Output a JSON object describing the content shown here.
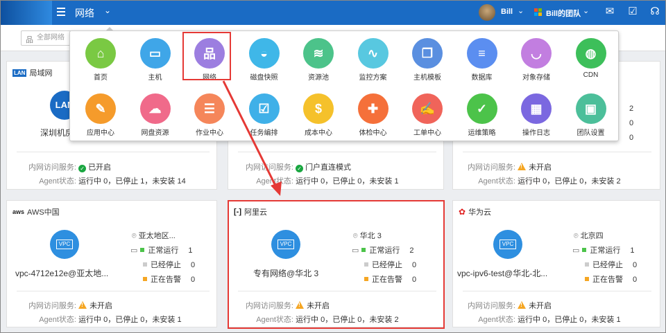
{
  "topbar": {
    "title": "网络",
    "user": "Bill",
    "team": "Bill的团队"
  },
  "search": {
    "placeholder": "全部网络"
  },
  "menu": [
    {
      "label": "首页",
      "color": "#7ac943",
      "icon": "home-icon",
      "glyph": "⌂"
    },
    {
      "label": "主机",
      "color": "#3fa6e8",
      "icon": "monitor-icon",
      "glyph": "▭"
    },
    {
      "label": "网络",
      "color": "#9c7ee0",
      "icon": "network-icon",
      "glyph": "品"
    },
    {
      "label": "磁盘快照",
      "color": "#3fb7e8",
      "icon": "disk-icon",
      "glyph": "◒"
    },
    {
      "label": "资源池",
      "color": "#4cc38a",
      "icon": "layers-icon",
      "glyph": "≋"
    },
    {
      "label": "监控方案",
      "color": "#58c8e0",
      "icon": "monitor-chart-icon",
      "glyph": "∿"
    },
    {
      "label": "主机模板",
      "color": "#5a8fe0",
      "icon": "template-icon",
      "glyph": "❐"
    },
    {
      "label": "数据库",
      "color": "#5b8ef0",
      "icon": "database-icon",
      "glyph": "≡"
    },
    {
      "label": "对象存储",
      "color": "#c27ee0",
      "icon": "bucket-icon",
      "glyph": "◡"
    },
    {
      "label": "CDN",
      "color": "#3dbf5a",
      "icon": "globe-icon",
      "glyph": "◍"
    },
    {
      "label": "应用中心",
      "color": "#f59b2b",
      "icon": "wrench-icon",
      "glyph": "✎"
    },
    {
      "label": "网盘资源",
      "color": "#f06a8a",
      "icon": "cloud-icon",
      "glyph": "☁"
    },
    {
      "label": "作业中心",
      "color": "#f5865a",
      "icon": "clipboard-icon",
      "glyph": "☰"
    },
    {
      "label": "任务编排",
      "color": "#3fb0e8",
      "icon": "task-icon",
      "glyph": "☑"
    },
    {
      "label": "成本中心",
      "color": "#f5c12b",
      "icon": "dollar-icon",
      "glyph": "$"
    },
    {
      "label": "体检中心",
      "color": "#f5703a",
      "icon": "medkit-icon",
      "glyph": "✚"
    },
    {
      "label": "工单中心",
      "color": "#f0645a",
      "icon": "ticket-icon",
      "glyph": "✍"
    },
    {
      "label": "运维策略",
      "color": "#4cc34a",
      "icon": "shield-icon",
      "glyph": "✓"
    },
    {
      "label": "操作日志",
      "color": "#7b68e0",
      "icon": "calendar-icon",
      "glyph": "▦"
    },
    {
      "label": "团队设置",
      "color": "#4cbf9a",
      "icon": "grid-icon",
      "glyph": "▣"
    }
  ],
  "cards": [
    {
      "provider": "局域网",
      "badge": "LAN",
      "vpc_name": "深圳机房",
      "vpc_glyph": "LAN",
      "loc": "",
      "running": "",
      "stopped": "",
      "alert": "",
      "service_label": "内网访问服务:",
      "service": "已开启",
      "service_ok": true,
      "agent_label": "Agent状态:",
      "agent": "运行中 0，已停止 1，未安装 14"
    },
    {
      "provider": "",
      "badge": "",
      "vpc_name": "",
      "vpc_glyph": "",
      "loc": "",
      "running": "",
      "stopped": "",
      "alert": "",
      "service_label": "内网访问服务:",
      "service": "门户直连模式",
      "service_ok": true,
      "agent_label": "Agent状态:",
      "agent": "运行中 0，已停止 0，未安装 1"
    },
    {
      "provider": "",
      "badge": "",
      "vpc_name": "",
      "vpc_glyph": "",
      "loc": "",
      "running": "2",
      "stopped": "0",
      "alert": "0",
      "service_label": "内网访问服务:",
      "service": "未开启",
      "service_ok": false,
      "agent_label": "Agent状态:",
      "agent": "运行中 0，已停止 0，未安装 2"
    },
    {
      "provider": "AWS中国",
      "badge": "aws",
      "vpc_name": "vpc-4712e12e@亚太地...",
      "vpc_glyph": "VPC",
      "loc": "亚太地区...",
      "running": "1",
      "stopped": "0",
      "alert": "0",
      "service_label": "内网访问服务:",
      "service": "未开启",
      "service_ok": false,
      "agent_label": "Agent状态:",
      "agent": "运行中 0，已停止 0，未安装 1"
    },
    {
      "provider": "阿里云",
      "badge": "ali",
      "vpc_name": "专有网络@华北 3",
      "vpc_glyph": "VPC",
      "loc": "华北 3",
      "running": "2",
      "stopped": "0",
      "alert": "0",
      "service_label": "内网访问服务:",
      "service": "未开启",
      "service_ok": false,
      "agent_label": "Agent状态:",
      "agent": "运行中 0，已停止 0，未安装 2"
    },
    {
      "provider": "华为云",
      "badge": "hw",
      "vpc_name": "vpc-ipv6-test@华北-北...",
      "vpc_glyph": "VPC",
      "loc": "北京四",
      "running": "1",
      "stopped": "0",
      "alert": "0",
      "service_label": "内网访问服务:",
      "service": "未开启",
      "service_ok": false,
      "agent_label": "Agent状态:",
      "agent": "运行中 0，已停止 0，未安装 1"
    }
  ],
  "status_labels": {
    "running": "正常运行",
    "stopped": "已经停止",
    "alert": "正在告警"
  },
  "colors": {
    "topbar": "#1a6bc4",
    "highlight": "#e53935",
    "running": "#4cc34a",
    "stopped": "#cccccc",
    "alert": "#f5a623"
  }
}
